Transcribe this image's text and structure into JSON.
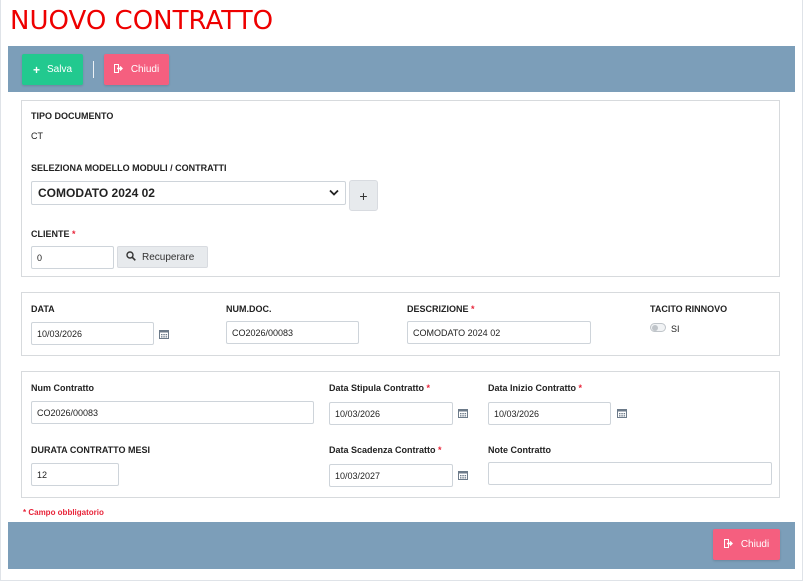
{
  "page": {
    "title": "NUOVO CONTRATTO"
  },
  "toolbar": {
    "save_label": "Salva",
    "close_label": "Chiudi"
  },
  "document": {
    "type_label": "TIPO DOCUMENTO",
    "type_value": "CT",
    "model_label": "SELEZIONA MODELLO MODULI / CONTRATTI",
    "model_value": "COMODATO 2024 02",
    "add_model_symbol": "+",
    "client_label": "CLIENTE",
    "client_value": "0",
    "recover_label": "Recuperare"
  },
  "header": {
    "date_label": "DATA",
    "date_value": "10/03/2026",
    "numdoc_label": "NUM.DOC.",
    "numdoc_value": "CO2026/00083",
    "description_label": "DESCRIZIONE",
    "description_value": "COMODATO 2024 02",
    "tacit_label": "TACITO RINNOVO",
    "tacit_option": "SI",
    "tacit_enabled": false
  },
  "contract": {
    "num_label": "Num Contratto",
    "num_value": "CO2026/00083",
    "stipula_label": "Data Stipula Contratto",
    "stipula_value": "10/03/2026",
    "inizio_label": "Data Inizio Contratto",
    "inizio_value": "10/03/2026",
    "durata_label": "DURATA CONTRATTO MESI",
    "durata_value": "12",
    "scadenza_label": "Data Scadenza Contratto",
    "scadenza_value": "10/03/2027",
    "note_label": "Note Contratto",
    "note_value": ""
  },
  "footer": {
    "required_note": "* Campo obbligatorio",
    "close_label": "Chiudi"
  },
  "required_mark": "*",
  "colors": {
    "title": "#ee0000",
    "toolbar": "#7c9eb9",
    "save": "#22c98f",
    "close": "#f55f7f",
    "required": "#e8253a"
  }
}
